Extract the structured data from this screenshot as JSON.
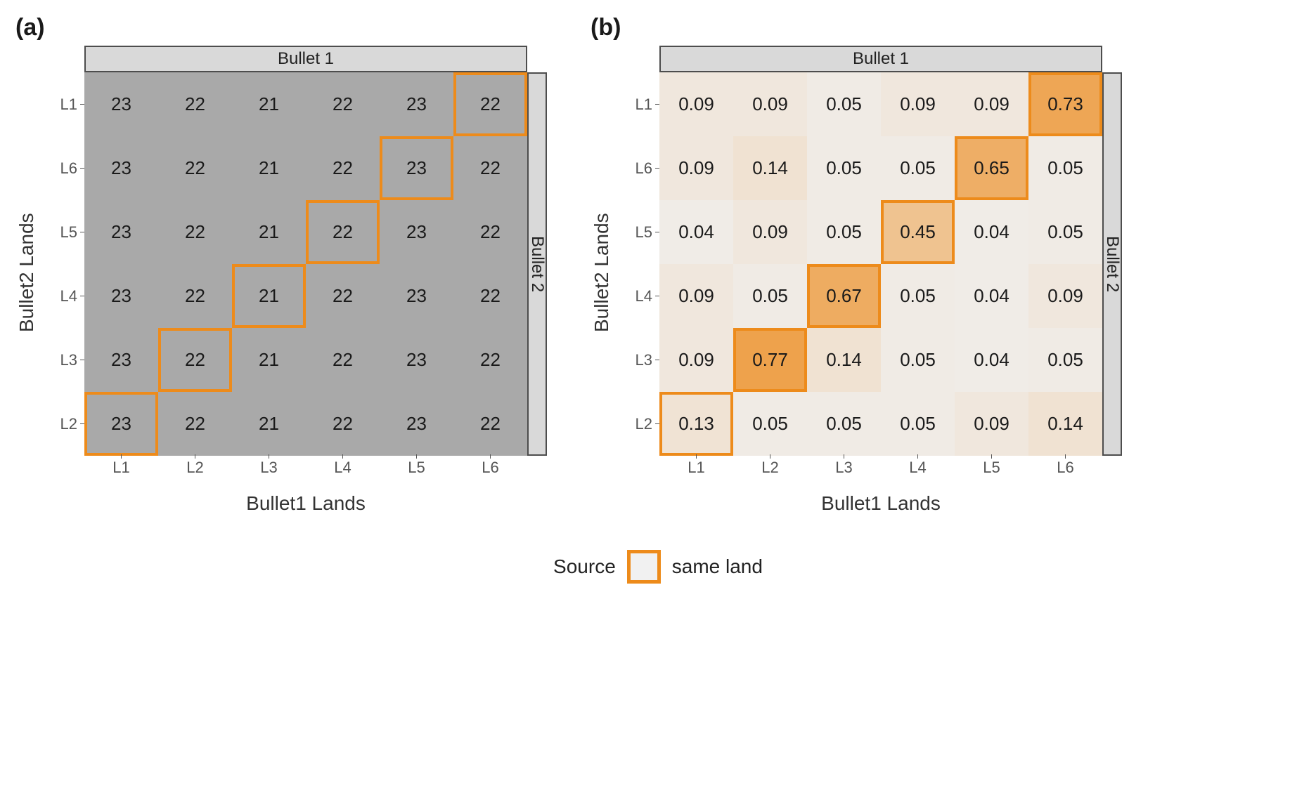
{
  "chart_data": [
    {
      "type": "heatmap",
      "panel": "a",
      "title": "",
      "xlabel": "Bullet1 Lands",
      "ylabel": "Bullet2 Lands",
      "strip_top": "Bullet 1",
      "strip_right": "Bullet 2",
      "x_categories": [
        "L1",
        "L2",
        "L3",
        "L4",
        "L5",
        "L6"
      ],
      "y_categories": [
        "L1",
        "L6",
        "L5",
        "L4",
        "L3",
        "L2"
      ],
      "values": [
        [
          23,
          22,
          21,
          22,
          23,
          22
        ],
        [
          23,
          22,
          21,
          22,
          23,
          22
        ],
        [
          23,
          22,
          21,
          22,
          23,
          22
        ],
        [
          23,
          22,
          21,
          22,
          23,
          22
        ],
        [
          23,
          22,
          21,
          22,
          23,
          22
        ],
        [
          23,
          22,
          21,
          22,
          23,
          22
        ]
      ],
      "value_range": [
        21,
        23
      ],
      "fill_low": "#f0f0f0",
      "fill_high": "#ed8b1b",
      "highlight_cells": [
        [
          0,
          5
        ],
        [
          1,
          4
        ],
        [
          2,
          3
        ],
        [
          3,
          2
        ],
        [
          4,
          1
        ],
        [
          5,
          0
        ]
      ],
      "highlight_color": "#ed8b1b",
      "highlight_label": "same land"
    },
    {
      "type": "heatmap",
      "panel": "b",
      "title": "",
      "xlabel": "Bullet1 Lands",
      "ylabel": "Bullet2 Lands",
      "strip_top": "Bullet 1",
      "strip_right": "Bullet 2",
      "x_categories": [
        "L1",
        "L2",
        "L3",
        "L4",
        "L5",
        "L6"
      ],
      "y_categories": [
        "L1",
        "L6",
        "L5",
        "L4",
        "L3",
        "L2"
      ],
      "values": [
        [
          0.09,
          0.09,
          0.05,
          0.09,
          0.09,
          0.73
        ],
        [
          0.09,
          0.14,
          0.05,
          0.05,
          0.65,
          0.05
        ],
        [
          0.04,
          0.09,
          0.05,
          0.45,
          0.04,
          0.05
        ],
        [
          0.09,
          0.05,
          0.67,
          0.05,
          0.04,
          0.09
        ],
        [
          0.09,
          0.77,
          0.14,
          0.05,
          0.04,
          0.05
        ],
        [
          0.13,
          0.05,
          0.05,
          0.05,
          0.09,
          0.14
        ]
      ],
      "value_range": [
        0.0,
        1.0
      ],
      "fill_low": "#f0f0f0",
      "fill_high": "#ed8b1b",
      "highlight_cells": [
        [
          0,
          5
        ],
        [
          1,
          4
        ],
        [
          2,
          3
        ],
        [
          3,
          2
        ],
        [
          4,
          1
        ],
        [
          5,
          0
        ]
      ],
      "highlight_color": "#ed8b1b",
      "highlight_label": "same land"
    }
  ],
  "panels": {
    "a": {
      "tag": "(a)"
    },
    "b": {
      "tag": "(b)"
    }
  },
  "legend": {
    "title": "Source",
    "item": "same land"
  }
}
